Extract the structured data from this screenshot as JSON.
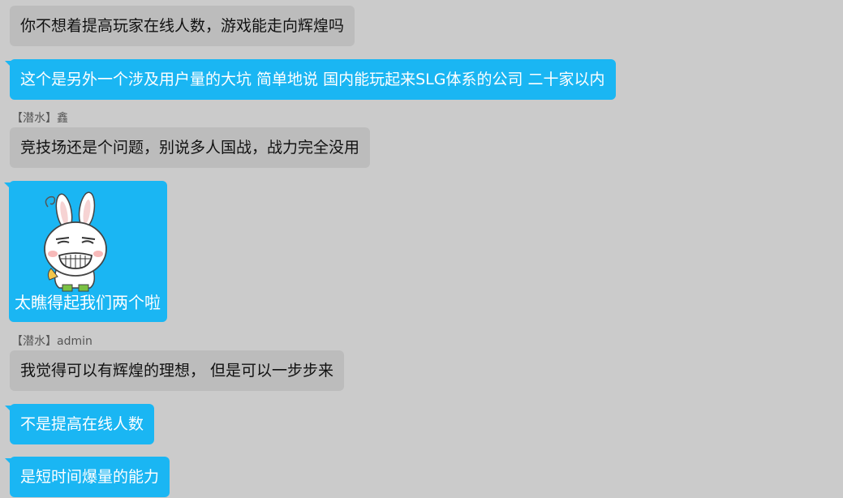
{
  "messages": [
    {
      "type": "text",
      "style": "gray",
      "text": "你不想着提高玩家在线人数，游戏能走向辉煌吗"
    },
    {
      "type": "text",
      "style": "blue",
      "text": "这个是另外一个涉及用户量的大坑 简单地说 国内能玩起来SLG体系的公司 二十家以内"
    },
    {
      "type": "sender",
      "text": "【潜水】鑫"
    },
    {
      "type": "text",
      "style": "gray",
      "text": "竞技场还是个问题，别说多人国战，战力完全没用"
    },
    {
      "type": "sticker",
      "style": "blue",
      "icon": "grinning-rabbit-sticker",
      "caption": "太瞧得起我们两个啦"
    },
    {
      "type": "sender",
      "text": "【潜水】admin"
    },
    {
      "type": "text",
      "style": "gray",
      "text": "我觉得可以有辉煌的理想， 但是可以一步步来"
    },
    {
      "type": "text",
      "style": "blue",
      "text": "不是提高在线人数"
    },
    {
      "type": "text",
      "style": "blue",
      "text": "是短时间爆量的能力"
    }
  ],
  "colors": {
    "background": "#cbcbcb",
    "gray_bubble": "#bcbcbc",
    "blue_bubble": "#1ab6f3",
    "sender_text": "#555555"
  }
}
